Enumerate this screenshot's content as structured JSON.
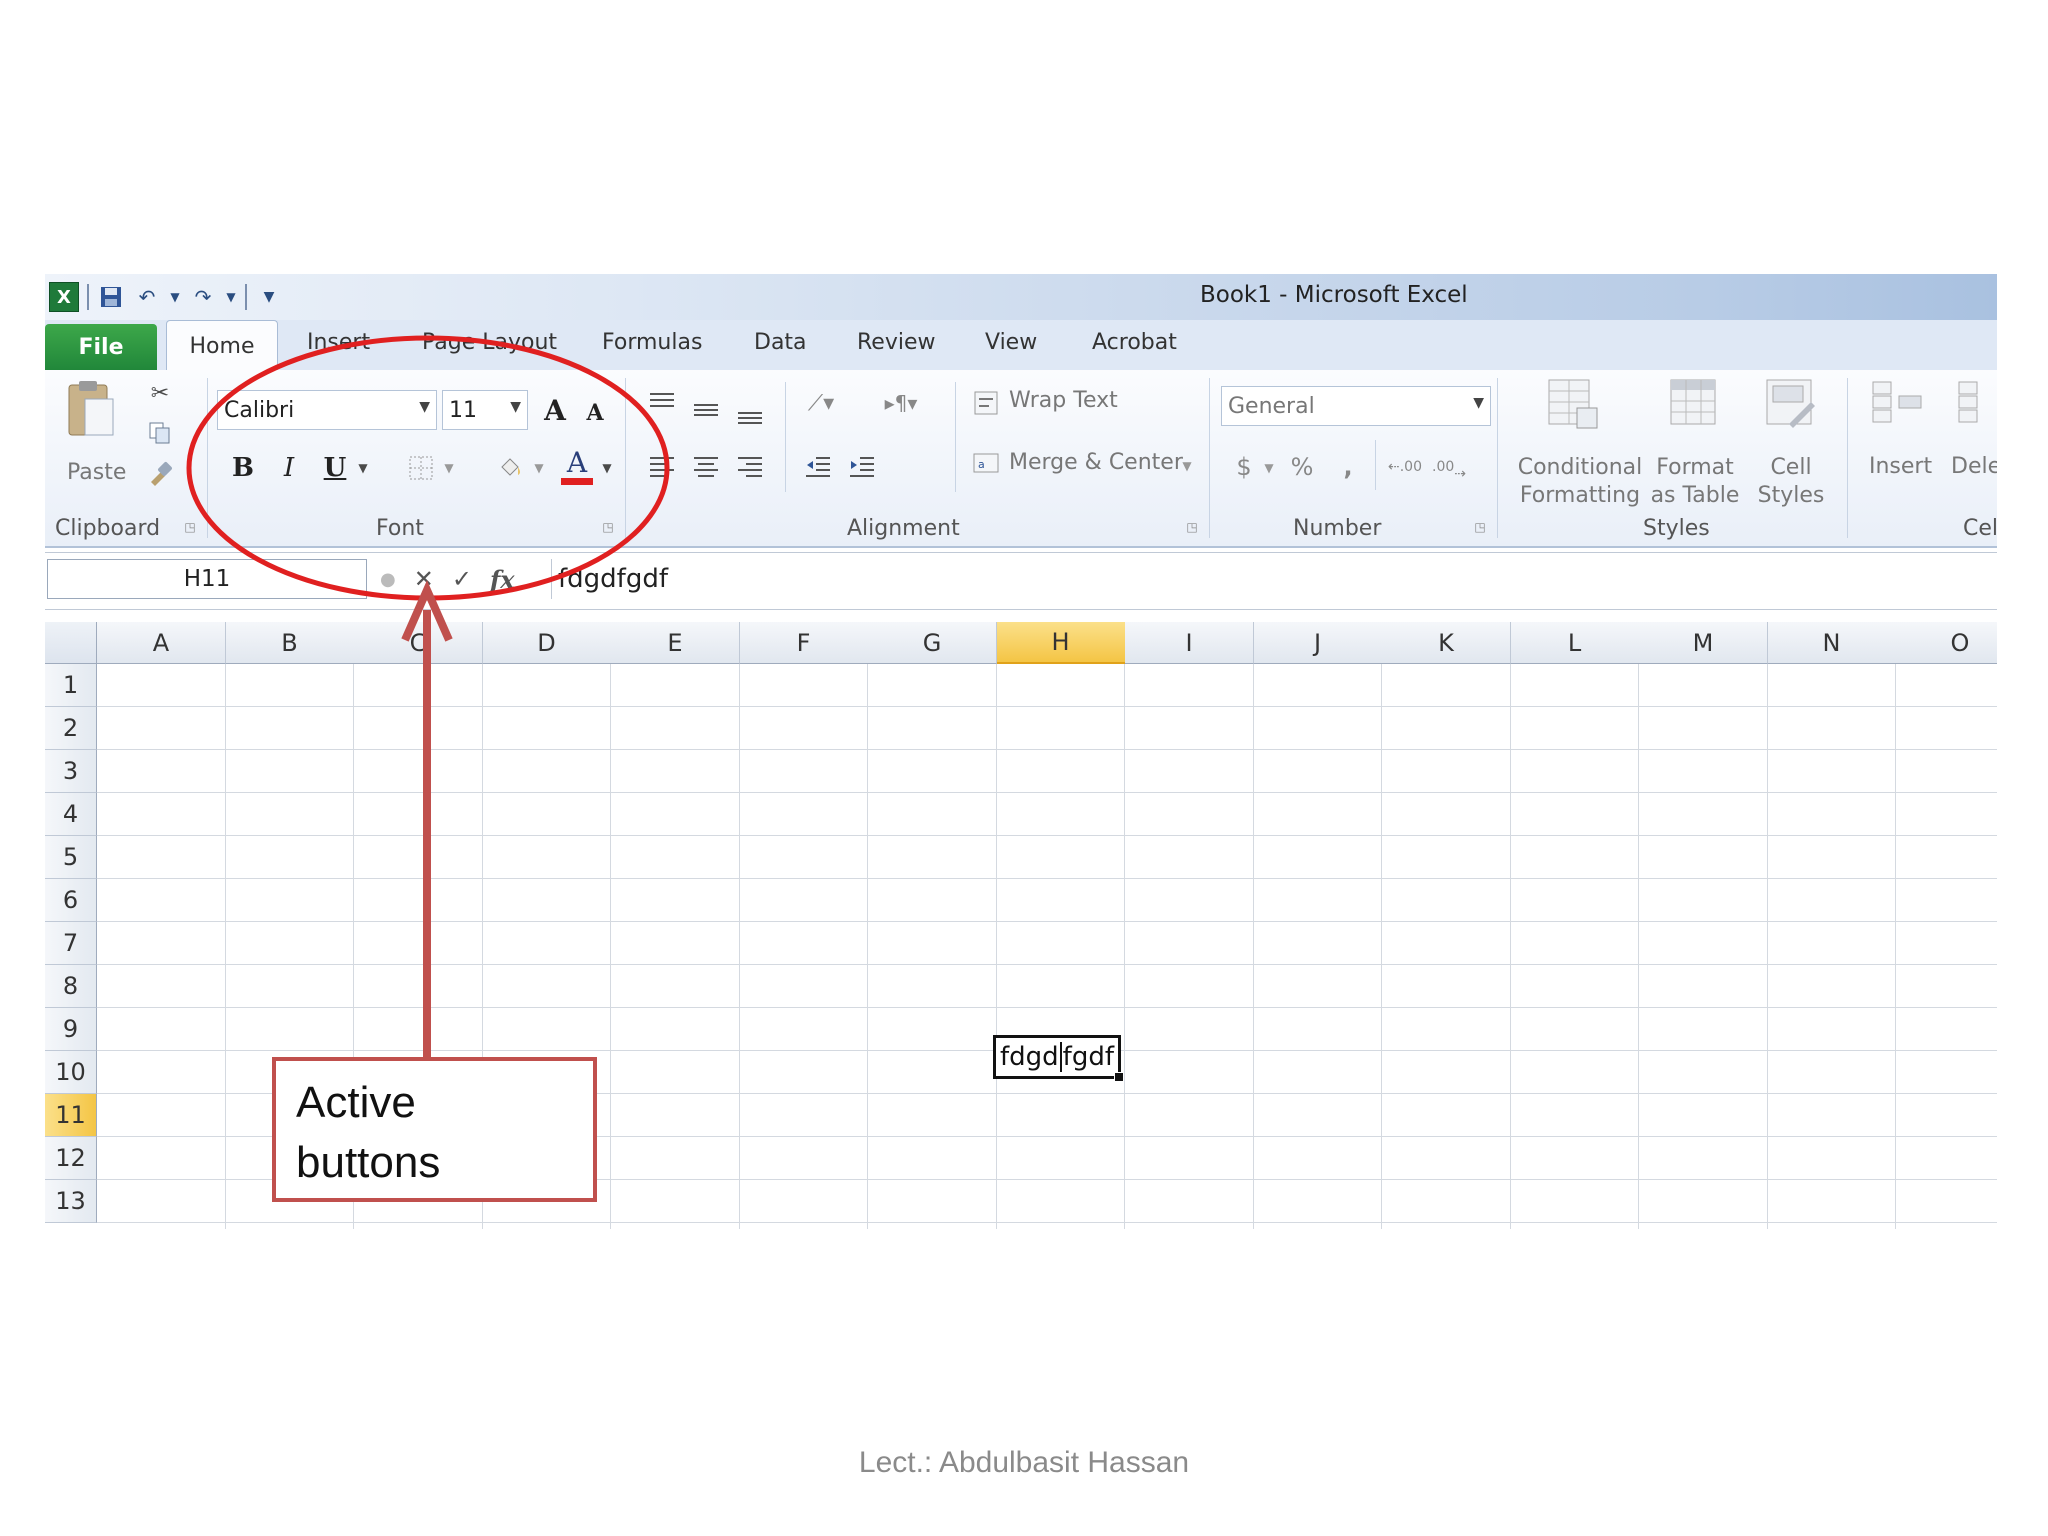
{
  "window": {
    "title": "Book1  -  Microsoft Excel"
  },
  "tabs": [
    "File",
    "Home",
    "Insert",
    "Page Layout",
    "Formulas",
    "Data",
    "Review",
    "View",
    "Acrobat"
  ],
  "ribbon": {
    "clipboard": {
      "paste_label": "Paste",
      "group_label": "Clipboard"
    },
    "font": {
      "name": "Calibri",
      "size": "11",
      "group_label": "Font",
      "bold": "B",
      "italic": "I",
      "underline": "U",
      "font_color_letter": "A",
      "grow": "A",
      "shrink": "A",
      "font_color": "#e02020"
    },
    "alignment": {
      "wrap_text": "Wrap Text",
      "merge_center": "Merge & Center",
      "group_label": "Alignment"
    },
    "number": {
      "format": "General",
      "currency": "$",
      "percent": "%",
      "comma": ",",
      "inc_dec": ".00",
      "group_label": "Number"
    },
    "styles": {
      "conditional_line1": "Conditional",
      "conditional_line2": "Formatting",
      "format_table_line1": "Format",
      "format_table_line2": "as Table",
      "cell_styles_line1": "Cell",
      "cell_styles_line2": "Styles",
      "group_label": "Styles"
    },
    "cells": {
      "insert": "Insert",
      "delete": "Dele",
      "group_label": "Cell"
    }
  },
  "formula_bar": {
    "name_box": "H11",
    "cancel": "✕",
    "enter": "✓",
    "fx": "fx",
    "value": "fdgdfgdf"
  },
  "sheet": {
    "columns": [
      "A",
      "B",
      "C",
      "D",
      "E",
      "F",
      "G",
      "H",
      "I",
      "J",
      "K",
      "L",
      "M",
      "N",
      "O"
    ],
    "rows": [
      "1",
      "2",
      "3",
      "4",
      "5",
      "6",
      "7",
      "8",
      "9",
      "10",
      "11",
      "12",
      "13"
    ],
    "active_column": "H",
    "active_row": "11",
    "active_cell_text_before": "fdgd",
    "active_cell_text_after": "fgdf"
  },
  "annotation": {
    "line1": "Active",
    "line2": "buttons",
    "color": "#e02020",
    "arrow_color": "#c0504d"
  },
  "footer": {
    "text": "Lect.: Abdulbasit Hassan"
  }
}
